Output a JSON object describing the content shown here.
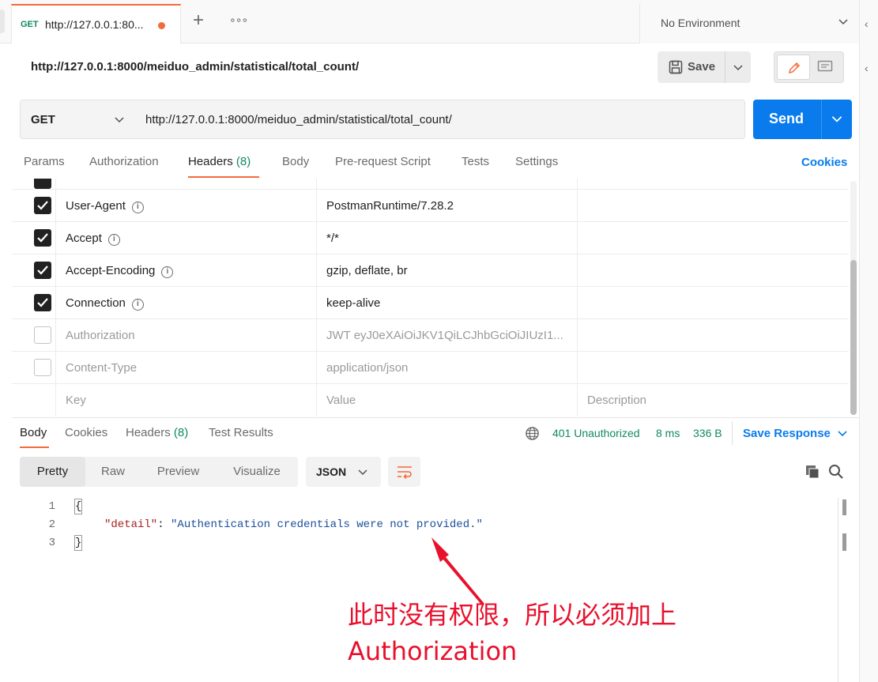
{
  "tab": {
    "method": "GET",
    "title": "http://127.0.0.1:80..."
  },
  "environment": {
    "label": "No Environment"
  },
  "request": {
    "title": "http://127.0.0.1:8000/meiduo_admin/statistical/total_count/",
    "method": "GET",
    "url": "http://127.0.0.1:8000/meiduo_admin/statistical/total_count/",
    "save_label": "Save",
    "send_label": "Send"
  },
  "request_tabs": [
    {
      "label": "Params"
    },
    {
      "label": "Authorization"
    },
    {
      "label": "Headers",
      "count": "(8)"
    },
    {
      "label": "Body"
    },
    {
      "label": "Pre-request Script"
    },
    {
      "label": "Tests"
    },
    {
      "label": "Settings"
    }
  ],
  "cookies_link": "Cookies",
  "headers": [
    {
      "key": "User-Agent",
      "value": "PostmanRuntime/7.28.2",
      "checked": true
    },
    {
      "key": "Accept",
      "value": "*/*",
      "checked": true
    },
    {
      "key": "Accept-Encoding",
      "value": "gzip, deflate, br",
      "checked": true
    },
    {
      "key": "Connection",
      "value": "keep-alive",
      "checked": true
    },
    {
      "key": "Authorization",
      "value": "JWT eyJ0eXAiOiJKV1QiLCJhbGciOiJIUzI1...",
      "checked": false
    },
    {
      "key": "Content-Type",
      "value": "application/json",
      "checked": false
    }
  ],
  "header_placeholders": {
    "key": "Key",
    "value": "Value",
    "description": "Description"
  },
  "response": {
    "tabs": [
      {
        "label": "Body"
      },
      {
        "label": "Cookies"
      },
      {
        "label": "Headers",
        "count": "(8)"
      },
      {
        "label": "Test Results"
      }
    ],
    "status": "401 Unauthorized",
    "time": "8 ms",
    "size": "336 B",
    "save_label": "Save Response",
    "formats": [
      "Pretty",
      "Raw",
      "Preview",
      "Visualize"
    ],
    "language": "JSON",
    "code": {
      "line_numbers": [
        "1",
        "2",
        "3"
      ],
      "open_brace": "{",
      "close_brace": "}",
      "key": "\"detail\"",
      "colon": ": ",
      "value": "\"Authentication credentials were not provided.\""
    }
  },
  "annotation": {
    "line1": "此时没有权限，所以必须加上",
    "line2": "Authorization",
    "color": "#e8112d"
  },
  "colors": {
    "accent": "#f26b3a",
    "primary": "#097bed",
    "success": "#0f8a5f"
  }
}
